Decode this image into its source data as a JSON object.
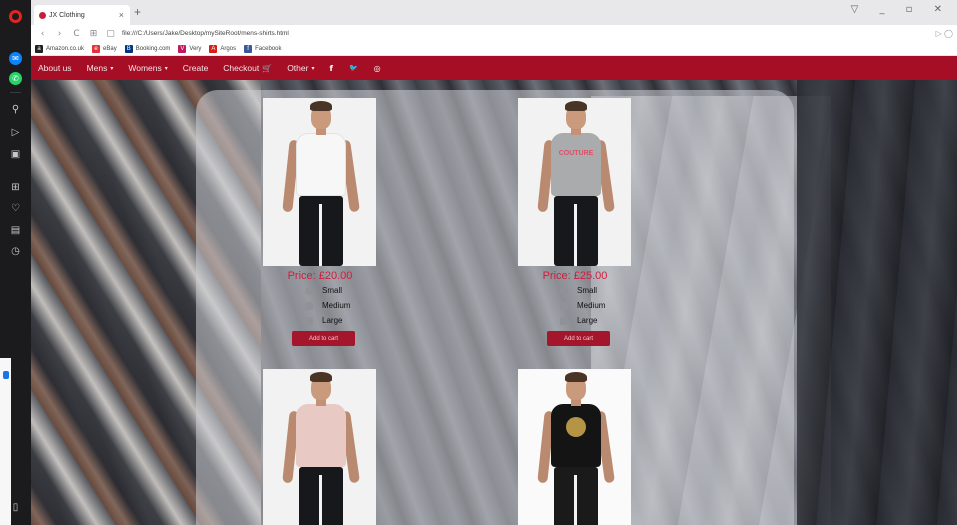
{
  "browser": {
    "tab_title": "JX Clothing",
    "tab_close": "×",
    "new_tab": "+",
    "window_controls": "▽ _ ▫ ✕",
    "url": "file:///C:/Users/Jake/Desktop/mySiteRoot/mens-shirts.html",
    "address_right": "▷ ◯",
    "nav_icons": {
      "back": "‹",
      "forward": "›",
      "reload": "C",
      "grid": "⊞",
      "page": "▢"
    },
    "bookmarks": [
      {
        "label": "Amazon.co.uk",
        "icon": "amazon-icon",
        "color": "#222222",
        "glyph": "a"
      },
      {
        "label": "eBay",
        "icon": "ebay-icon",
        "color": "#e53238",
        "glyph": "e"
      },
      {
        "label": "Booking.com",
        "icon": "booking-icon",
        "color": "#003580",
        "glyph": "B"
      },
      {
        "label": "Very",
        "icon": "very-icon",
        "color": "#c2185b",
        "glyph": "V"
      },
      {
        "label": "Argos",
        "icon": "argos-icon",
        "color": "#d42114",
        "glyph": "A"
      },
      {
        "label": "Facebook",
        "icon": "facebook-icon",
        "color": "#3b5998",
        "glyph": "f"
      }
    ]
  },
  "sidebar": {
    "icons": [
      "opera-logo-icon",
      "messenger-icon",
      "whatsapp-icon",
      "search-icon",
      "send-icon",
      "camera-icon",
      "grid-icon",
      "heart-icon",
      "news-icon",
      "history-icon",
      "sidebar-toggle-icon"
    ]
  },
  "nav": {
    "items": [
      {
        "label": "About us",
        "dropdown": false
      },
      {
        "label": "Mens",
        "dropdown": true
      },
      {
        "label": "Womens",
        "dropdown": true
      },
      {
        "label": "Create",
        "dropdown": false
      },
      {
        "label": "Checkout",
        "dropdown": false,
        "icon": "cart-icon"
      },
      {
        "label": "Other",
        "dropdown": true
      }
    ],
    "social": [
      {
        "icon": "facebook-icon",
        "glyph": "f"
      },
      {
        "icon": "twitter-icon",
        "glyph": "🐦"
      },
      {
        "icon": "instagram-icon",
        "glyph": "◎"
      }
    ],
    "caret": "▾",
    "cart_glyph": "🛒"
  },
  "products": [
    {
      "price": "Price: £20.00",
      "shirt_color": "#f7f7f7",
      "print": "",
      "sizes": [
        "Small",
        "Medium",
        "Large"
      ],
      "button": "Add to cart"
    },
    {
      "price": "Price: £25.00",
      "shirt_color": "#a9abad",
      "print": "COUTURE",
      "sizes": [
        "Small",
        "Medium",
        "Large"
      ],
      "button": "Add to cart"
    },
    {
      "shirt_color": "#e8c9c4",
      "print": ""
    },
    {
      "shirt_color": "#141414",
      "print": ""
    }
  ],
  "colors": {
    "navbar": "#a50e24",
    "price": "#d31c3d",
    "button": "#a3162c"
  }
}
